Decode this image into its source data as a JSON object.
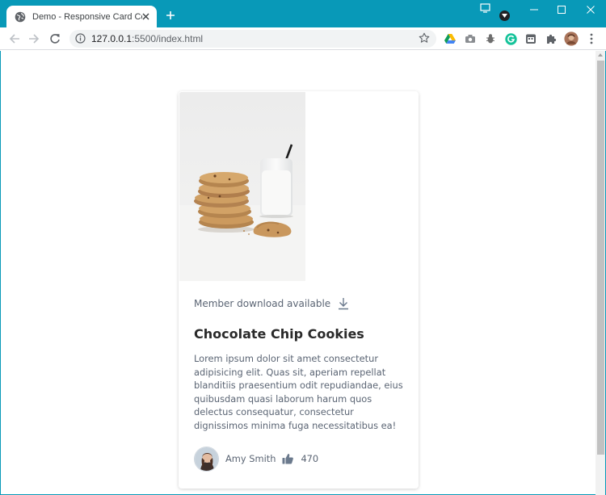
{
  "browser": {
    "tab_title": "Demo - Responsive Card Compo",
    "url_host": "127.0.0.1",
    "url_rest": ":5500/index.html",
    "accent_color": "#0899b8",
    "icons": {
      "favicon": "globe-icon",
      "tab_close": "close-icon",
      "new_tab": "plus-icon",
      "back": "arrow-left-icon",
      "forward": "arrow-right-icon",
      "reload": "reload-icon",
      "site_info": "info-icon",
      "bookmark": "star-icon",
      "extensions": [
        "google-drive-icon",
        "camera-icon",
        "bug-icon",
        "grammarly-icon",
        "calendar-icon",
        "puzzle-icon",
        "profile-avatar",
        "more-vert-icon"
      ],
      "window": [
        "minimize-icon",
        "maximize-icon",
        "close-icon"
      ]
    }
  },
  "card": {
    "download_text": "Member download available",
    "title": "Chocolate Chip Cookies",
    "body": "Lorem ipsum dolor sit amet consectetur adipisicing elit. Quas sit, aperiam repellat blanditiis praesentium odit repudiandae, eius quibusdam quasi laborum harum quos delectus consequatur, consectetur dignissimos minima fuga necessitatibus ea!",
    "author": "Amy Smith",
    "likes": "470",
    "text_color": "#5b6574",
    "title_color": "#2a2a2a"
  }
}
